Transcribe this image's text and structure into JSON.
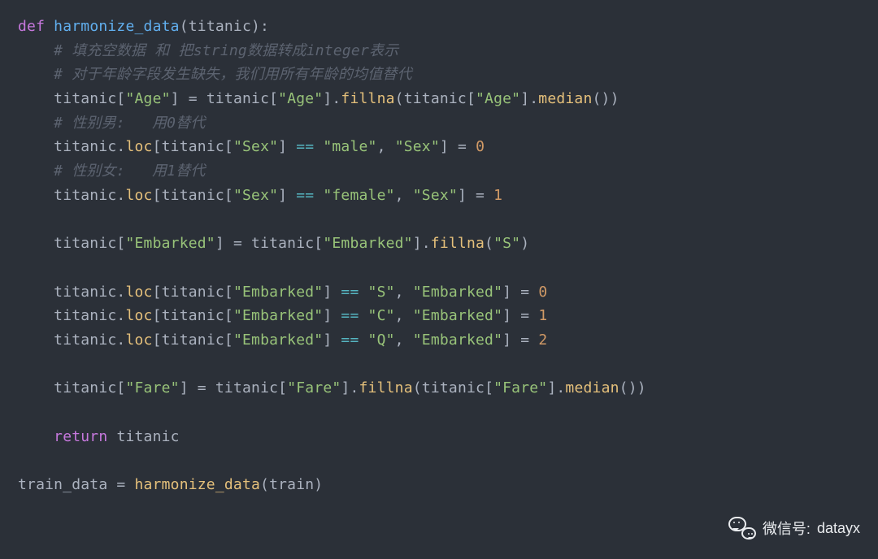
{
  "code": {
    "kw_def": "def",
    "fn_name": "harmonize_data",
    "param": "titanic",
    "c1": "# 填充空数据 和 把string数据转成integer表示",
    "c2": "# 对于年龄字段发生缺失，我们用所有年龄的均值替代",
    "s_age": "\"Age\"",
    "m_fillna": "fillna",
    "m_median": "median",
    "c3": "# 性别男:   用0替代",
    "m_loc": "loc",
    "s_sex": "\"Sex\"",
    "s_male": "\"male\"",
    "n0": "0",
    "c4": "# 性别女:   用1替代",
    "s_female": "\"female\"",
    "n1": "1",
    "s_emb": "\"Embarked\"",
    "s_S": "\"S\"",
    "s_C": "\"C\"",
    "s_Q": "\"Q\"",
    "n2": "2",
    "s_fare": "\"Fare\"",
    "kw_return": "return",
    "assign_lhs": "train_data",
    "assign_rhs_fn": "harmonize_data",
    "assign_rhs_arg": "train"
  },
  "watermark": {
    "label": "微信号:",
    "value": "datayx"
  }
}
